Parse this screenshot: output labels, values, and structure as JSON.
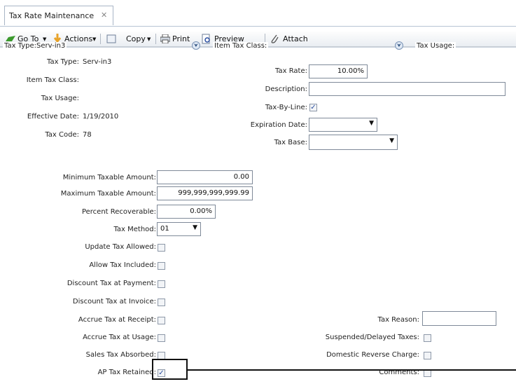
{
  "tab": {
    "title": "Tax Rate Maintenance",
    "close_glyph": "✕"
  },
  "toolbar": {
    "goto_label": "Go To",
    "actions_label": "Actions",
    "copy_label": "Copy",
    "print_label": "Print",
    "preview_label": "Preview",
    "attach_label": "Attach"
  },
  "group_header": {
    "tax_type": "Tax Type:Serv-in3",
    "item_tax_class": "Item Tax Class:",
    "tax_usage": "Tax Usage:"
  },
  "left_fields": {
    "tax_type_label": "Tax Type:",
    "tax_type_value": "Serv-in3",
    "item_tax_class_label": "Item Tax Class:",
    "tax_usage_label": "Tax Usage:",
    "effective_date_label": "Effective Date:",
    "effective_date_value": "1/19/2010",
    "tax_code_label": "Tax Code:",
    "tax_code_value": "78"
  },
  "right_fields": {
    "tax_rate_label": "Tax Rate:",
    "tax_rate_value": "10.00%",
    "description_label": "Description:",
    "description_value": "",
    "tax_by_line_label": "Tax-By-Line:",
    "expiration_date_label": "Expiration Date:",
    "expiration_date_value": "",
    "tax_base_label": "Tax Base:",
    "tax_base_value": ""
  },
  "amounts": {
    "min_taxable_label": "Minimum Taxable Amount:",
    "min_taxable_value": "0.00",
    "max_taxable_label": "Maximum Taxable Amount:",
    "max_taxable_value": "999,999,999,999.99",
    "percent_recoverable_label": "Percent Recoverable:",
    "percent_recoverable_value": "0.00%",
    "tax_method_label": "Tax Method:",
    "tax_method_value": "01"
  },
  "checkboxes": {
    "update_tax_allowed": {
      "label": "Update Tax Allowed:",
      "checked": false
    },
    "allow_tax_included": {
      "label": "Allow Tax Included:",
      "checked": false
    },
    "discount_tax_at_payment": {
      "label": "Discount Tax at Payment:",
      "checked": false
    },
    "discount_tax_at_invoice": {
      "label": "Discount Tax at Invoice:",
      "checked": false
    },
    "accrue_tax_at_receipt": {
      "label": "Accrue Tax at Receipt:",
      "checked": false
    },
    "accrue_tax_at_usage": {
      "label": "Accrue Tax at Usage:",
      "checked": false
    },
    "sales_tax_absorbed": {
      "label": "Sales Tax Absorbed:",
      "checked": false
    },
    "ap_tax_retained": {
      "label": "AP Tax Retained:",
      "checked": true
    },
    "suspended_delayed_taxes": {
      "label": "Suspended/Delayed Taxes:",
      "checked": false
    },
    "domestic_reverse_charge": {
      "label": "Domestic Reverse Charge:",
      "checked": false
    },
    "comments": {
      "label": "Comments:",
      "checked": false
    }
  },
  "tax_reason": {
    "label": "Tax Reason:",
    "value": ""
  },
  "glyphs": {
    "check": "✓",
    "dropdown": "▼",
    "expand": "⮟",
    "menu_arrow": "▼"
  },
  "colors": {
    "accent": "#2a4ea0",
    "highlight_border": "#111111"
  }
}
